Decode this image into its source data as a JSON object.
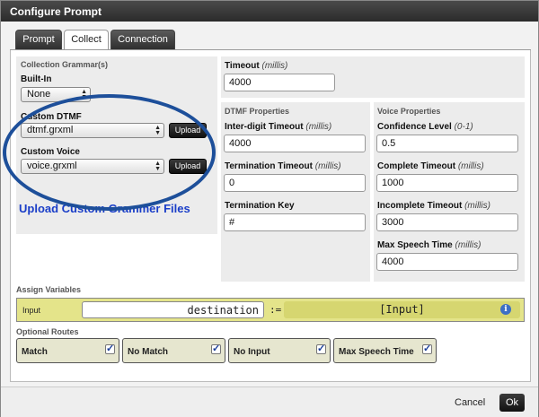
{
  "window": {
    "title": "Configure Prompt"
  },
  "tabs": [
    {
      "label": "Prompt"
    },
    {
      "label": "Collect"
    },
    {
      "label": "Connection"
    }
  ],
  "grammar": {
    "heading": "Collection Grammar(s)",
    "builtin_label": "Built-In",
    "builtin_value": "None",
    "dtmf_label": "Custom DTMF",
    "dtmf_value": "dtmf.grxml",
    "voice_label": "Custom Voice",
    "voice_value": "voice.grxml",
    "upload_label": "Upload",
    "upload_link": "Upload Custom Grammer Files"
  },
  "timeout": {
    "label": "Timeout",
    "unit": "(millis)",
    "value": "4000"
  },
  "dtmf_props": {
    "heading": "DTMF Properties",
    "interdigit_label": "Inter-digit Timeout",
    "interdigit_unit": "(millis)",
    "interdigit_value": "4000",
    "termination_label": "Termination Timeout",
    "termination_unit": "(millis)",
    "termination_value": "0",
    "termkey_label": "Termination Key",
    "termkey_value": "#"
  },
  "voice_props": {
    "heading": "Voice Properties",
    "confidence_label": "Confidence Level",
    "confidence_unit": "(0-1)",
    "confidence_value": "0.5",
    "complete_label": "Complete Timeout",
    "complete_unit": "(millis)",
    "complete_value": "1000",
    "incomplete_label": "Incomplete Timeout",
    "incomplete_unit": "(millis)",
    "incomplete_value": "3000",
    "maxspeech_label": "Max Speech Time",
    "maxspeech_unit": "(millis)",
    "maxspeech_value": "4000"
  },
  "assign": {
    "heading": "Assign Variables",
    "row_label": "Input",
    "variable": "destination",
    "operator": ":=",
    "value": "[Input]"
  },
  "routes": {
    "heading": "Optional Routes",
    "items": [
      {
        "label": "Match",
        "checked": true
      },
      {
        "label": "No Match",
        "checked": true
      },
      {
        "label": "No Input",
        "checked": true
      },
      {
        "label": "Max Speech Time",
        "checked": true
      }
    ],
    "check_glyph": "✓"
  },
  "footer": {
    "cancel_label": "Cancel",
    "ok_label": "Ok"
  },
  "icons": {
    "info": "i",
    "select_arrows": "▲▼"
  }
}
